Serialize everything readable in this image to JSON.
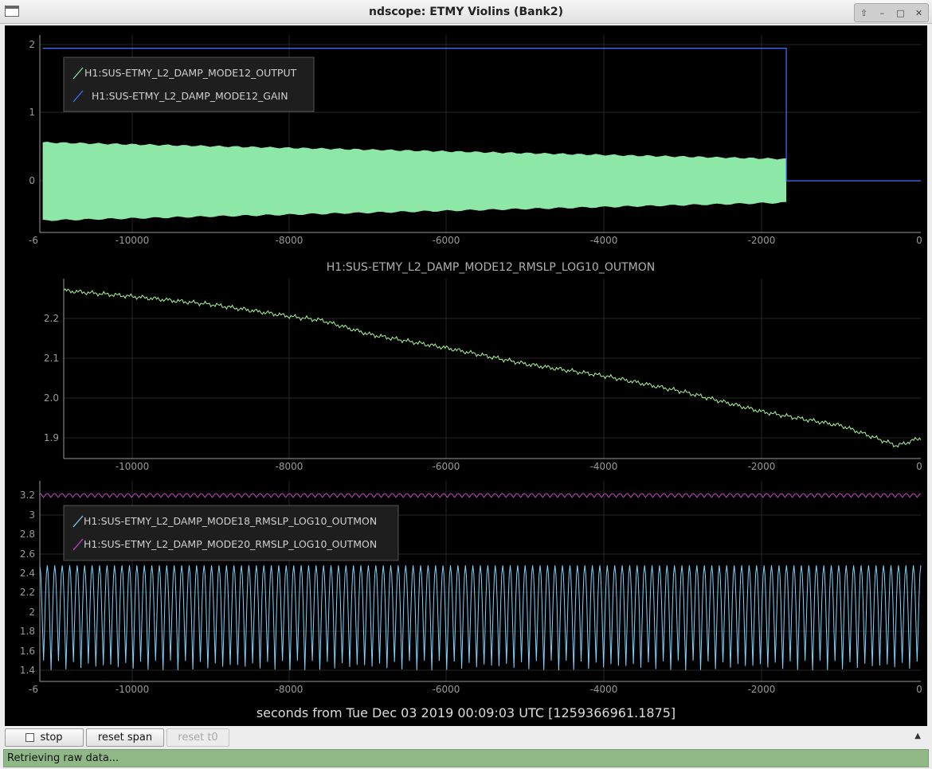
{
  "window": {
    "title": "ndscope: ETMY Violins (Bank2)",
    "controls": [
      "⇧",
      "–",
      "□",
      "✕"
    ]
  },
  "colors": {
    "background": "#000000",
    "axis": "#9a9a9a",
    "output_fill": "#8de8a8",
    "gain_line": "#3f74ff",
    "mode12_line": "#a9f79a",
    "mode18_line": "#7fd3ff",
    "mode20_line": "#c843c8"
  },
  "plots": {
    "p1": {
      "legend": [
        "H1:SUS-ETMY_L2_DAMP_MODE12_OUTPUT",
        "H1:SUS-ETMY_L2_DAMP_MODE12_GAIN"
      ],
      "yticks": [
        "2",
        "1",
        "0"
      ],
      "xticks": [
        "-6",
        "-10000",
        "-8000",
        "-6000",
        "-4000",
        "-2000",
        "0"
      ]
    },
    "p2": {
      "title": "H1:SUS-ETMY_L2_DAMP_MODE12_RMSLP_LOG10_OUTMON",
      "yticks": [
        "2.2",
        "2.1",
        "2.0",
        "1.9"
      ],
      "xticks": [
        "-10000",
        "-8000",
        "-6000",
        "-4000",
        "-2000",
        "0"
      ]
    },
    "p3": {
      "legend": [
        "H1:SUS-ETMY_L2_DAMP_MODE18_RMSLP_LOG10_OUTMON",
        "H1:SUS-ETMY_L2_DAMP_MODE20_RMSLP_LOG10_OUTMON"
      ],
      "yticks": [
        "3.2",
        "3",
        "2.8",
        "2.6",
        "2.4",
        "2.2",
        "2",
        "1.8",
        "1.6",
        "1.4"
      ],
      "xticks": [
        "-6",
        "-10000",
        "-8000",
        "-6000",
        "-4000",
        "-2000",
        "0"
      ]
    },
    "xlabel": "seconds from Tue Dec 03 2019 00:09:03 UTC [1259366961.1875]"
  },
  "toolbar": {
    "stop_label": "stop",
    "reset_span_label": "reset span",
    "reset_t0_label": "reset t0",
    "collapse_icon": "▲"
  },
  "status": {
    "text": "Retrieving raw data..."
  },
  "chart_data": [
    {
      "type": "area",
      "x_range": [
        -11000,
        0
      ],
      "ylim": [
        -0.78,
        2.2
      ],
      "series": [
        {
          "name": "H1:SUS-ETMY_L2_DAMP_MODE12_OUTPUT",
          "x": [
            -10964,
            -1680
          ],
          "upper": [
            0.58,
            0.33
          ],
          "lower": [
            -0.6,
            -0.33
          ]
        },
        {
          "name": "H1:SUS-ETMY_L2_DAMP_MODE12_GAIN",
          "x": [
            -10964,
            -1680,
            -1680,
            0
          ],
          "y": [
            2,
            2,
            0,
            0
          ]
        }
      ]
    },
    {
      "type": "line",
      "title": "H1:SUS-ETMY_L2_DAMP_MODE12_RMSLP_LOG10_OUTMON",
      "x_range": [
        -10880,
        0
      ],
      "ylim": [
        1.87,
        2.3
      ],
      "x": [
        -10880,
        -10000,
        -9000,
        -8000,
        -7600,
        -7000,
        -6000,
        -5000,
        -4000,
        -3000,
        -2000,
        -1000,
        -300,
        0
      ],
      "y": [
        2.27,
        2.255,
        2.235,
        2.205,
        2.195,
        2.16,
        2.125,
        2.085,
        2.055,
        2.015,
        1.965,
        1.93,
        1.88,
        1.9
      ]
    },
    {
      "type": "line",
      "x_range": [
        -11000,
        0
      ],
      "ylim": [
        1.3,
        3.3
      ],
      "series": [
        {
          "name": "H1:SUS-ETMY_L2_DAMP_MODE18_RMSLP_LOG10_OUTMON",
          "min": 1.45,
          "max": 2.48,
          "cycles": 118
        },
        {
          "name": "H1:SUS-ETMY_L2_DAMP_MODE20_RMSLP_LOG10_OUTMON",
          "min": 3.18,
          "max": 3.22,
          "cycles": 120
        }
      ]
    }
  ]
}
